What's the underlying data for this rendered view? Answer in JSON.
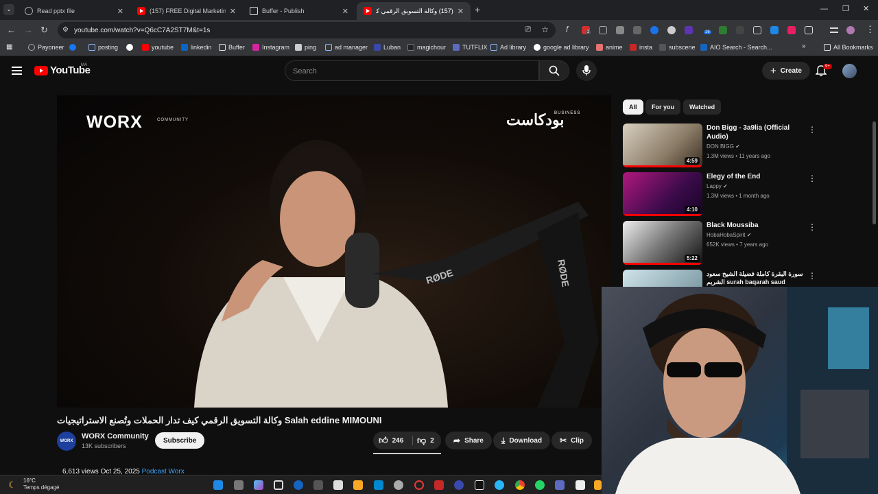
{
  "browser": {
    "tabs": [
      {
        "title": "Read pptx file",
        "icon": "gear-icon"
      },
      {
        "title": "(157) FREE Digital Marketing Co",
        "icon": "youtube-icon"
      },
      {
        "title": "Buffer - Publish",
        "icon": "buffer-icon"
      },
      {
        "title": "(157) وكالة التسويق الرقمي كيف...",
        "icon": "youtube-icon"
      }
    ],
    "url": "youtube.com/watch?v=Q6cC7A2ST7M&t=1s",
    "bookmarks": [
      "Payoneer",
      "posting",
      "youtube",
      "linkedin",
      "Buffer",
      "Instagram",
      "ping",
      "ad manager",
      "Luban",
      "magichour",
      "TUTFLIX",
      "Ad library",
      "google ad library",
      "anime",
      "insta",
      "subscene",
      "AIO Search - Search..."
    ],
    "all_bookmarks": "All Bookmarks",
    "extension_badges": [
      "2",
      "16"
    ]
  },
  "youtube": {
    "logo_text": "YouTube",
    "country_code": "MA",
    "search_placeholder": "Search",
    "create_label": "Create",
    "notif_badge": "9+",
    "player": {
      "brand": "WORX",
      "brand_sub": "COMMUNITY",
      "podcast_logo": "بودكاست",
      "podcast_sub": "BUSINESS"
    },
    "video_title": "وكالة التسويق الرقمي كيف تدار الحملات وتُصنع الاستراتيجيات Salah eddine MIMOUNI",
    "channel": {
      "avatar_text": "WORX",
      "name": "WORX Community",
      "subs": "13K subscribers",
      "subscribe": "Subscribe"
    },
    "actions": {
      "likes": "246",
      "dislikes": "2",
      "share": "Share",
      "download": "Download",
      "clip": "Clip"
    },
    "meta": {
      "views": "6,613 views",
      "date": "Oct 25, 2025",
      "tag": "Podcast Worx"
    },
    "filter_chips": [
      "All",
      "For you",
      "Watched"
    ],
    "recommendations": [
      {
        "title": "Don Bigg - 3a9lia (Official Audio)",
        "channel": "DON BIGG",
        "stats": "1.3M views • 11 years ago",
        "duration": "4:59",
        "progress": 1.0
      },
      {
        "title": "Elegy of the End",
        "channel": "Lappy",
        "stats": "1.3M views • 1 month ago",
        "duration": "4:10",
        "progress": 1.0
      },
      {
        "title": "Black Moussiba",
        "channel": "HobaHobaSpirit",
        "stats": "652K views • 7 years ago",
        "duration": "5:22",
        "progress": 1.0
      },
      {
        "title": "سورة البقرة كاملة فضيلة الشيخ سعود الشريم surah baqarah saud shuraim",
        "channel": "",
        "stats": "",
        "duration": "",
        "progress": 0
      }
    ]
  },
  "taskbar": {
    "temp": "16°C",
    "weather": "Temps dégagé"
  },
  "colors": {
    "brand_red": "#ff0000",
    "link_blue": "#3ea6ff",
    "bg": "#0f0f0f"
  }
}
